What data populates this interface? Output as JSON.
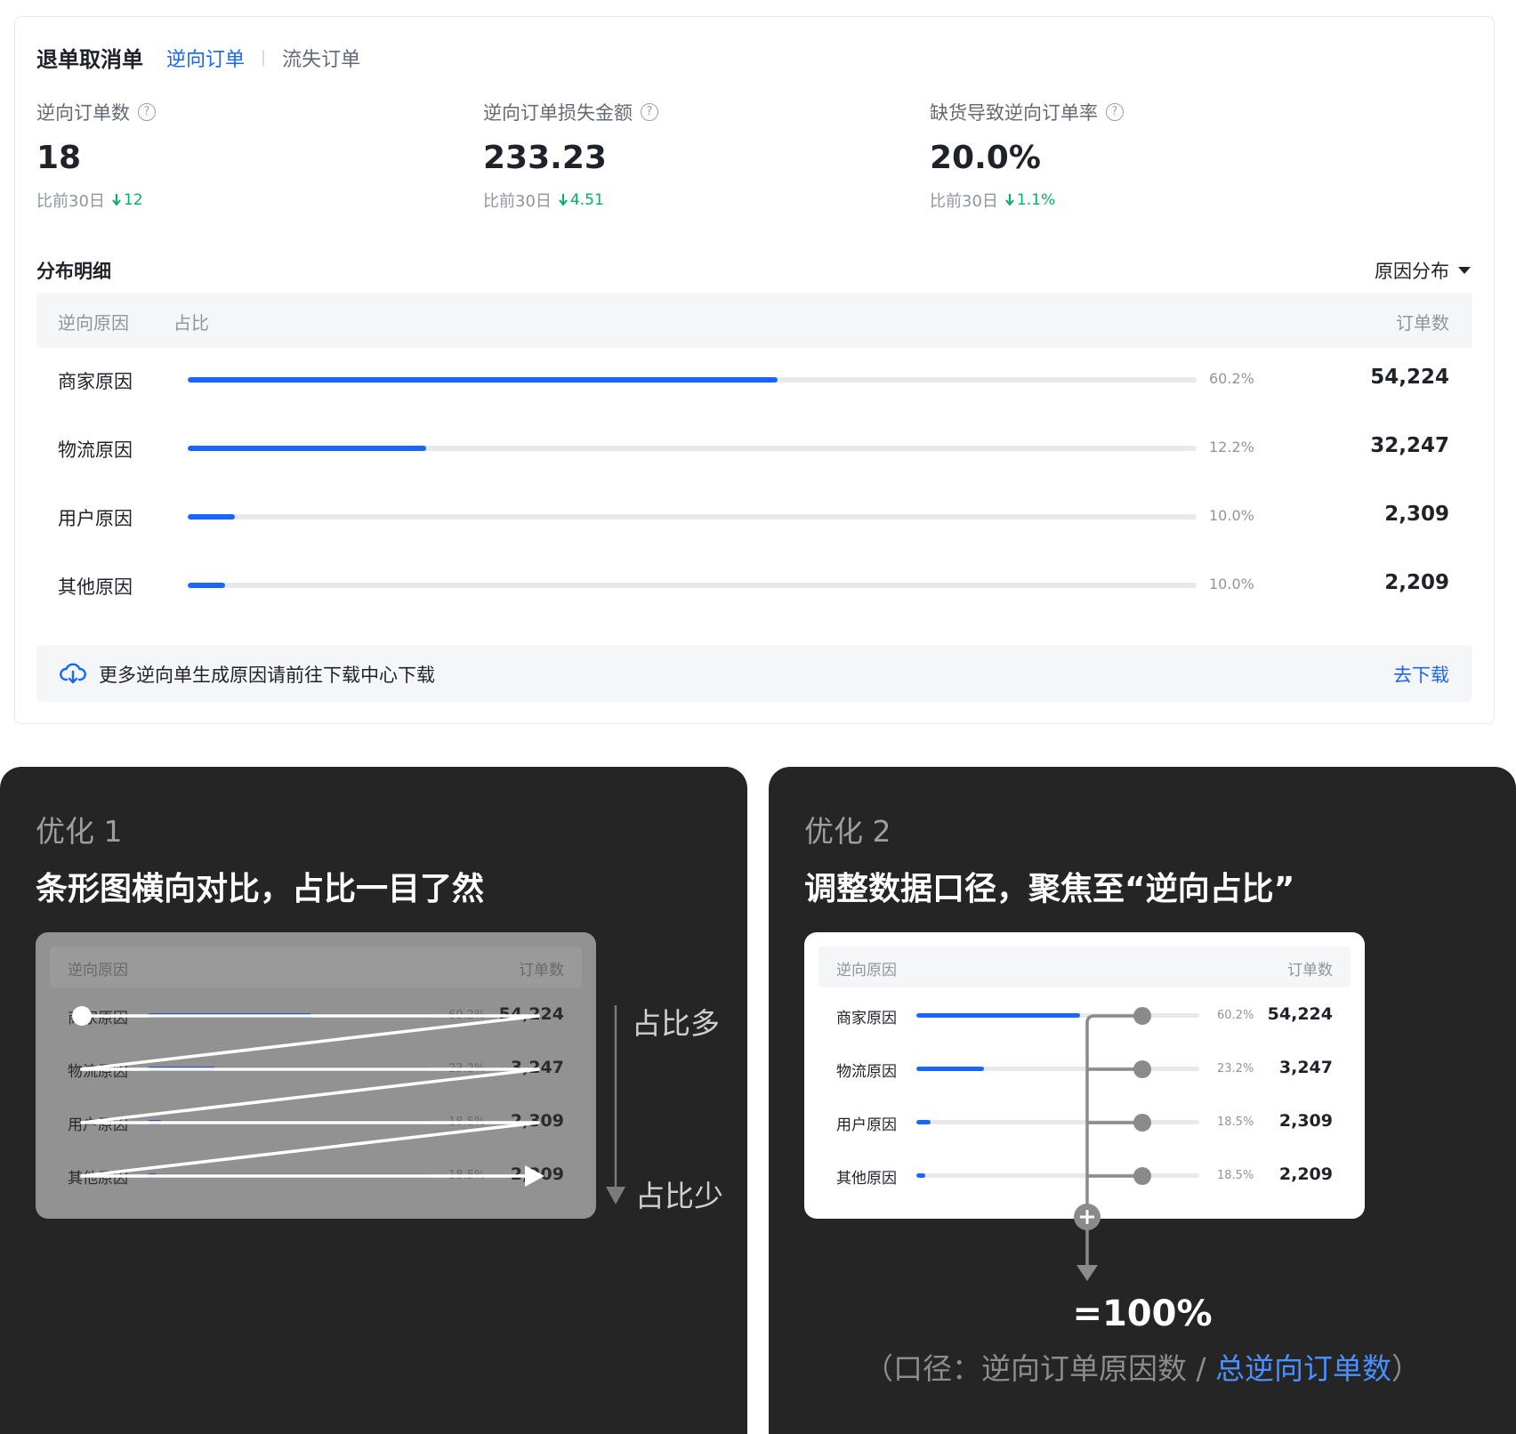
{
  "header": {
    "title": "退单取消单",
    "tabs": [
      {
        "label": "逆向订单",
        "active": true
      },
      {
        "label": "流失订单",
        "active": false
      }
    ]
  },
  "metrics": [
    {
      "label": "逆向订单数",
      "value": "18",
      "compare_label": "比前30日",
      "delta": "12",
      "direction": "down"
    },
    {
      "label": "逆向订单损失金额",
      "value": "233.23",
      "compare_label": "比前30日",
      "delta": "4.51",
      "direction": "down"
    },
    {
      "label": "缺货导致逆向订单率",
      "value": "20.0%",
      "compare_label": "比前30日",
      "delta": "1.1%",
      "direction": "down"
    }
  ],
  "distribution": {
    "title": "分布明细",
    "dropdown_label": "原因分布",
    "columns": {
      "reason": "逆向原因",
      "ratio": "占比",
      "count": "订单数"
    },
    "rows": [
      {
        "label": "商家原因",
        "ratio": 0.585,
        "pct": "60.2%",
        "count": "54,224"
      },
      {
        "label": "物流原因",
        "ratio": 0.236,
        "pct": "12.2%",
        "count": "32,247"
      },
      {
        "label": "用户原因",
        "ratio": 0.047,
        "pct": "10.0%",
        "count": "2,309"
      },
      {
        "label": "其他原因",
        "ratio": 0.037,
        "pct": "10.0%",
        "count": "2,209"
      }
    ]
  },
  "notice": {
    "text": "更多逆向单生成原因请前往下载中心下载",
    "link": "去下载"
  },
  "panel1": {
    "kicker": "优化 1",
    "heading": "条形图横向对比，占比一目了然",
    "columns": {
      "reason": "逆向原因",
      "count": "订单数"
    },
    "rows": [
      {
        "label": "商家原因",
        "ratio": 0.58,
        "pct": "60.2%",
        "count": "54,224"
      },
      {
        "label": "物流原因",
        "ratio": 0.24,
        "pct": "23.2%",
        "count": "3,247"
      },
      {
        "label": "用户原因",
        "ratio": 0.05,
        "pct": "18.5%",
        "count": "2,309"
      },
      {
        "label": "其他原因",
        "ratio": 0.03,
        "pct": "18.5%",
        "count": "2,209"
      }
    ],
    "label_more": "占比多",
    "label_less": "占比少"
  },
  "panel2": {
    "kicker": "优化 2",
    "heading": "调整数据口径，聚焦至“逆向占比”",
    "columns": {
      "reason": "逆向原因",
      "count": "订单数"
    },
    "rows": [
      {
        "label": "商家原因",
        "ratio": 0.58,
        "pct": "60.2%",
        "count": "54,224"
      },
      {
        "label": "物流原因",
        "ratio": 0.24,
        "pct": "23.2%",
        "count": "3,247"
      },
      {
        "label": "用户原因",
        "ratio": 0.05,
        "pct": "18.5%",
        "count": "2,309"
      },
      {
        "label": "其他原因",
        "ratio": 0.03,
        "pct": "18.5%",
        "count": "2,209"
      }
    ],
    "result": "=100%",
    "formula_prefix": "（口径：逆向订单原因数 / ",
    "formula_accent": "总逆向订单数",
    "formula_suffix": "）"
  },
  "colors": {
    "accent": "#1966ff",
    "positive": "#00b266",
    "panel_bg": "#252525"
  }
}
